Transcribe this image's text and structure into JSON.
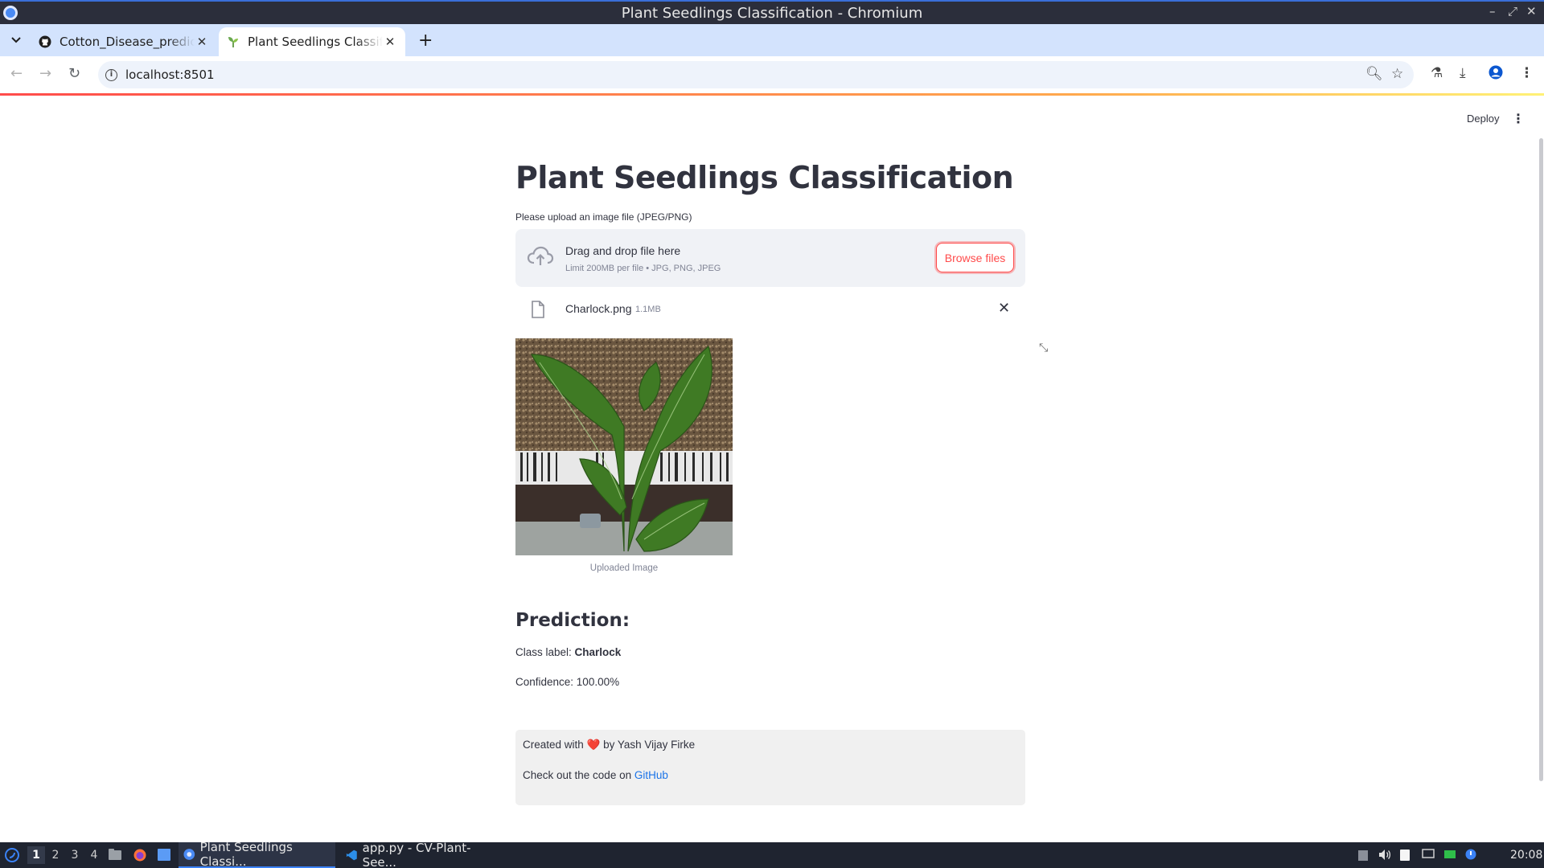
{
  "window": {
    "title": "Plant Seedlings Classification - Chromium",
    "minimize_glyph": "–",
    "maximize_glyph": "⤢",
    "close_glyph": "✕"
  },
  "tabs": [
    {
      "label": "Cotton_Disease_prediction",
      "icon": "github-icon",
      "close": "✕"
    },
    {
      "label": "Plant Seedlings Classification",
      "icon": "seedling-icon",
      "close": "✕"
    }
  ],
  "new_tab_glyph": "+",
  "toolbar": {
    "back_glyph": "←",
    "forward_glyph": "→",
    "reload_glyph": "↻",
    "url": "localhost:8501",
    "info_glyph": "i",
    "zoom_glyph": "🔍︎",
    "bookmark_glyph": "☆",
    "labs_glyph": "⚗",
    "download_glyph": "⤓",
    "menu_glyph": "⋮"
  },
  "app": {
    "deploy_label": "Deploy",
    "menu_glyph": "⋮",
    "title": "Plant Seedlings Classification",
    "upload_label": "Please upload an image file (JPEG/PNG)",
    "dropzone": {
      "title": "Drag and drop file here",
      "limit": "Limit 200MB per file • JPG, PNG, JPEG",
      "browse_label": "Browse files"
    },
    "uploaded_file": {
      "name": "Charlock.png",
      "size": "1.1MB",
      "remove_glyph": "✕"
    },
    "expand_glyph": "⤡",
    "image_caption": "Uploaded Image",
    "prediction": {
      "heading": "Prediction:",
      "class_prefix": "Class label: ",
      "class_value": "Charlock",
      "confidence_text": "Confidence: 100.00%"
    },
    "footer": {
      "created_prefix": "Created with ",
      "heart": "❤️",
      "created_suffix": " by Yash Vijay Firke",
      "code_prefix": "Check out the code on ",
      "link_label": "GitHub"
    }
  },
  "taskbar": {
    "workspaces": [
      "1",
      "2",
      "3",
      "4"
    ],
    "active_workspace": "1",
    "tasks": [
      {
        "label": "Plant Seedlings Classi...",
        "icon": "chromium-icon"
      },
      {
        "label": "app.py - CV-Plant-See...",
        "icon": "vscode-icon"
      }
    ],
    "clock": "20:08"
  },
  "colors": {
    "accent": "#ff4b4b",
    "link": "#1a73e8",
    "tab_strip": "#d3e3fd",
    "title_bar": "#2b2e3b",
    "taskbar": "#1f2430"
  }
}
